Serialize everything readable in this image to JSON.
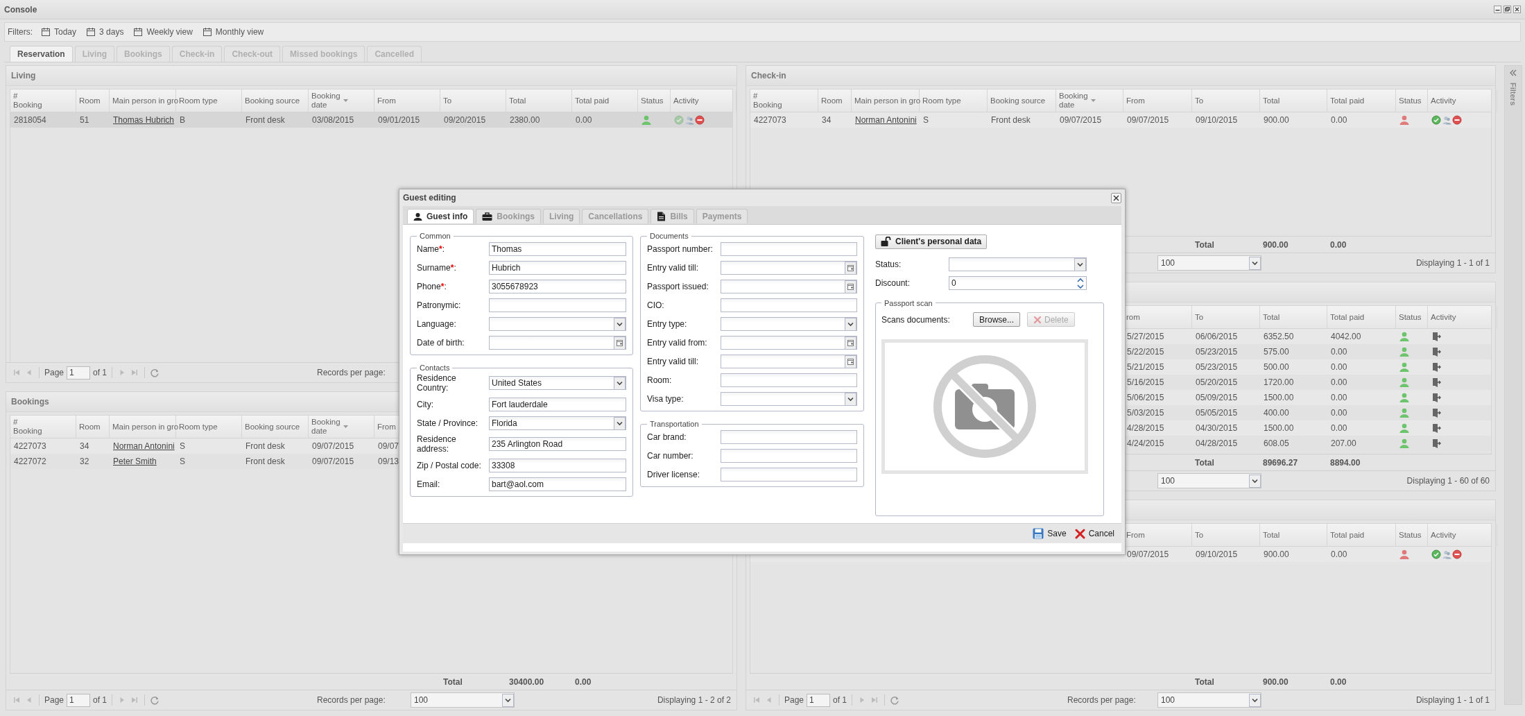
{
  "window": {
    "title": "Console"
  },
  "filters": {
    "label": "Filters:",
    "items": [
      "Today",
      "3 days",
      "Weekly view",
      "Monthly view"
    ]
  },
  "tabs": [
    {
      "label": "Reservation",
      "selected": true
    },
    {
      "label": "Living",
      "selected": false
    },
    {
      "label": "Bookings",
      "selected": false
    },
    {
      "label": "Check-in",
      "selected": false
    },
    {
      "label": "Check-out",
      "selected": false
    },
    {
      "label": "Missed bookings",
      "selected": false
    },
    {
      "label": "Cancelled",
      "selected": false
    }
  ],
  "left_panels": [
    {
      "title": "Living",
      "columns": [
        {
          "label": "#\nBooking",
          "kind": "text",
          "sorted": false
        },
        {
          "label": "Room",
          "kind": "text",
          "sorted": false
        },
        {
          "label": "Main person in gro",
          "kind": "link",
          "sorted": false
        },
        {
          "label": "Room type",
          "kind": "text",
          "sorted": false
        },
        {
          "label": "Booking source",
          "kind": "text",
          "sorted": false
        },
        {
          "label": "Booking\ndate",
          "kind": "text",
          "sorted": true
        },
        {
          "label": "From",
          "kind": "text",
          "sorted": false
        },
        {
          "label": "To",
          "kind": "text",
          "sorted": false
        },
        {
          "label": "Total",
          "kind": "text",
          "sorted": false
        },
        {
          "label": "Total paid",
          "kind": "text",
          "sorted": false
        },
        {
          "label": "Status",
          "kind": "status",
          "sorted": false
        },
        {
          "label": "Activity",
          "kind": "activity",
          "sorted": false
        }
      ],
      "rows": [
        {
          "selected": true,
          "cells": [
            "2818054",
            "51",
            "Thomas Hubrich",
            "B",
            "Front desk",
            "03/08/2015",
            "09/01/2015",
            "09/20/2015",
            "2380.00",
            "0.00",
            {
              "color": "#6cc46c"
            },
            [
              {
                "kind": "check",
                "disabled": true
              },
              {
                "kind": "guest",
                "disabled": false
              },
              {
                "kind": "cancel",
                "disabled": false
              }
            ]
          ]
        }
      ],
      "pager": {
        "page_label": "Page",
        "page": "1",
        "page_count": "of 1",
        "records_label": "Records per page:"
      }
    },
    {
      "title": "Bookings",
      "columns": [
        {
          "label": "#\nBooking",
          "kind": "text",
          "sorted": false
        },
        {
          "label": "Room",
          "kind": "text",
          "sorted": false
        },
        {
          "label": "Main person in gro",
          "kind": "link",
          "sorted": false
        },
        {
          "label": "Room type",
          "kind": "text",
          "sorted": false
        },
        {
          "label": "Booking source",
          "kind": "text",
          "sorted": false
        },
        {
          "label": "Booking\ndate",
          "kind": "text",
          "sorted": true
        },
        {
          "label": "From",
          "kind": "text",
          "sorted": false
        }
      ],
      "rows": [
        {
          "selected": false,
          "cells": [
            "4227073",
            "34",
            "Norman Antonini",
            "S",
            "Front desk",
            "09/07/2015",
            "09/07"
          ]
        },
        {
          "selected": false,
          "cells": [
            "4227072",
            "32",
            "Peter Smith",
            "S",
            "Front desk",
            "09/07/2015",
            "09/13"
          ]
        }
      ],
      "total": {
        "label": "Total",
        "total": "30400.00",
        "paid": "0.00"
      },
      "pager": {
        "page_label": "Page",
        "page": "1",
        "page_count": "of 1",
        "records_label": "Records per page:",
        "per_page": "100",
        "display": "Displaying 1 - 2 of 2"
      }
    }
  ],
  "right_panels": [
    {
      "title": "Check-in",
      "columns": [
        {
          "label": "#\nBooking",
          "kind": "text",
          "sorted": false
        },
        {
          "label": "Room",
          "kind": "text",
          "sorted": false
        },
        {
          "label": "Main person in gro",
          "kind": "link",
          "sorted": false
        },
        {
          "label": "Room type",
          "kind": "text",
          "sorted": false
        },
        {
          "label": "Booking source",
          "kind": "text",
          "sorted": false
        },
        {
          "label": "Booking\ndate",
          "kind": "text",
          "sorted": true
        },
        {
          "label": "From",
          "kind": "text",
          "sorted": false
        },
        {
          "label": "To",
          "kind": "text",
          "sorted": false
        },
        {
          "label": "Total",
          "kind": "text",
          "sorted": false
        },
        {
          "label": "Total paid",
          "kind": "text",
          "sorted": false
        },
        {
          "label": "Status",
          "kind": "status",
          "sorted": false
        },
        {
          "label": "Activity",
          "kind": "activity",
          "sorted": false
        }
      ],
      "rows": [
        {
          "selected": false,
          "cells": [
            "4227073",
            "34",
            "Norman Antonini",
            "S",
            "Front desk",
            "09/07/2015",
            "09/07/2015",
            "09/10/2015",
            "900.00",
            "0.00",
            {
              "color": "#e07a7a"
            },
            [
              {
                "kind": "check",
                "disabled": false
              },
              {
                "kind": "guest",
                "disabled": false
              },
              {
                "kind": "cancel",
                "disabled": false
              }
            ]
          ]
        }
      ],
      "total": {
        "label": "Total",
        "total": "900.00",
        "paid": "0.00"
      },
      "pager": {
        "per_page": "100",
        "display": "Displaying 1 - 1 of 1"
      }
    },
    {
      "columns": [
        {
          "label": "rom",
          "kind": "text",
          "sorted": false
        },
        {
          "label": "To",
          "kind": "text",
          "sorted": false
        },
        {
          "label": "Total",
          "kind": "text",
          "sorted": false
        },
        {
          "label": "Total paid",
          "kind": "text",
          "sorted": false
        },
        {
          "label": "Status",
          "kind": "status",
          "sorted": false
        },
        {
          "label": "Activity",
          "kind": "activity",
          "sorted": false
        }
      ],
      "rows": [
        {
          "selected": false,
          "cells": [
            "5/27/2015",
            "06/06/2015",
            "6352.50",
            "4042.00",
            {
              "color": "#6cc46c"
            },
            [
              {
                "kind": "exit",
                "disabled": false
              }
            ]
          ]
        },
        {
          "selected": false,
          "cells": [
            "5/22/2015",
            "05/23/2015",
            "575.00",
            "0.00",
            {
              "color": "#6cc46c"
            },
            [
              {
                "kind": "exit",
                "disabled": false
              }
            ]
          ]
        },
        {
          "selected": false,
          "cells": [
            "5/21/2015",
            "05/23/2015",
            "500.00",
            "0.00",
            {
              "color": "#6cc46c"
            },
            [
              {
                "kind": "exit",
                "disabled": false
              }
            ]
          ]
        },
        {
          "selected": false,
          "cells": [
            "5/16/2015",
            "05/20/2015",
            "1720.00",
            "0.00",
            {
              "color": "#6cc46c"
            },
            [
              {
                "kind": "exit",
                "disabled": false
              }
            ]
          ]
        },
        {
          "selected": false,
          "cells": [
            "5/06/2015",
            "05/09/2015",
            "1500.00",
            "0.00",
            {
              "color": "#6cc46c"
            },
            [
              {
                "kind": "exit",
                "disabled": false
              }
            ]
          ]
        },
        {
          "selected": false,
          "cells": [
            "5/03/2015",
            "05/05/2015",
            "400.00",
            "0.00",
            {
              "color": "#6cc46c"
            },
            [
              {
                "kind": "exit",
                "disabled": false
              }
            ]
          ]
        },
        {
          "selected": false,
          "cells": [
            "4/28/2015",
            "04/30/2015",
            "1500.00",
            "0.00",
            {
              "color": "#6cc46c"
            },
            [
              {
                "kind": "exit",
                "disabled": false
              }
            ]
          ]
        },
        {
          "selected": false,
          "cells": [
            "4/24/2015",
            "04/28/2015",
            "608.05",
            "207.00",
            {
              "color": "#6cc46c"
            },
            [
              {
                "kind": "exit",
                "disabled": false
              }
            ]
          ]
        }
      ],
      "total": {
        "label": "Total",
        "total": "89696.27",
        "paid": "8894.00"
      },
      "pager": {
        "per_page": "100",
        "display": "Displaying 1 - 60 of 60"
      }
    },
    {
      "columns": [
        {
          "label": "From",
          "kind": "text",
          "sorted": false
        },
        {
          "label": "To",
          "kind": "text",
          "sorted": false
        },
        {
          "label": "Total",
          "kind": "text",
          "sorted": false
        },
        {
          "label": "Total paid",
          "kind": "text",
          "sorted": false
        },
        {
          "label": "Status",
          "kind": "status",
          "sorted": false
        },
        {
          "label": "Activity",
          "kind": "activity",
          "sorted": false
        }
      ],
      "rows": [
        {
          "selected": false,
          "cells": [
            "09/07/2015",
            "09/10/2015",
            "900.00",
            "0.00",
            {
              "color": "#e07a7a"
            },
            [
              {
                "kind": "check",
                "disabled": false
              },
              {
                "kind": "guest",
                "disabled": false
              },
              {
                "kind": "cancel",
                "disabled": false
              }
            ]
          ]
        }
      ],
      "total": {
        "label": "Total",
        "total": "900.00",
        "paid": "0.00"
      },
      "pager": {
        "page_label": "Page",
        "page": "1",
        "page_count": "of 1",
        "records_label": "Records per page:",
        "per_page": "100",
        "display": "Displaying 1 - 1 of 1"
      }
    }
  ],
  "filters_sidebar": {
    "label": "Filters"
  },
  "dialog": {
    "title": "Guest editing",
    "tabs": [
      {
        "label": "Guest info",
        "kind": "person",
        "selected": true
      },
      {
        "label": "Bookings",
        "kind": "briefcase",
        "selected": false
      },
      {
        "label": "Living",
        "kind": "plain",
        "selected": false
      },
      {
        "label": "Cancellations",
        "kind": "plain",
        "selected": false
      },
      {
        "label": "Bills",
        "kind": "document",
        "selected": false
      },
      {
        "label": "Payments",
        "kind": "plain",
        "selected": false
      }
    ],
    "columns": [
      [
        {
          "legend": "Common",
          "fields": [
            {
              "label": "Name",
              "mark": "*",
              "suffix": ":",
              "kind": "text",
              "value": "Thomas"
            },
            {
              "label": "Surname",
              "mark": "*",
              "suffix": ":",
              "kind": "text",
              "value": "Hubrich"
            },
            {
              "label": "Phone",
              "mark": "*",
              "suffix": ":",
              "kind": "text",
              "value": "3055678923"
            },
            {
              "label": "Patronymic:",
              "kind": "text"
            },
            {
              "label": "Language:",
              "kind": "combo"
            },
            {
              "label": "Date of birth:",
              "kind": "date"
            }
          ]
        },
        {
          "legend": "Contacts",
          "fields": [
            {
              "label": "Residence\nCountry:",
              "kind": "combo",
              "value": "United States"
            },
            {
              "label": "City:",
              "kind": "text",
              "value": "Fort lauderdale"
            },
            {
              "label": "State / Province:",
              "kind": "combo",
              "value": "Florida"
            },
            {
              "label": "Residence\naddress:",
              "kind": "text",
              "value": "235 Arlington Road"
            },
            {
              "label": "Zip / Postal code:",
              "kind": "text",
              "value": "33308"
            },
            {
              "label": "Email:",
              "kind": "text",
              "value": "bart@aol.com"
            }
          ]
        }
      ],
      [
        {
          "legend": "Documents",
          "fields": [
            {
              "label": "Passport number:",
              "kind": "text"
            },
            {
              "label": "Entry valid till:",
              "kind": "date"
            },
            {
              "label": "Passport issued:",
              "kind": "date"
            },
            {
              "label": "CIO:",
              "kind": "text"
            },
            {
              "label": "Entry type:",
              "kind": "combo"
            },
            {
              "label": "Entry valid from:",
              "kind": "date"
            },
            {
              "label": "Entry valid till:",
              "kind": "date"
            },
            {
              "label": "Room:",
              "kind": "text"
            },
            {
              "label": "Visa type:",
              "kind": "combo"
            }
          ]
        },
        {
          "legend": "Transportation",
          "fields": [
            {
              "label": "Car brand:",
              "kind": "text"
            },
            {
              "label": "Car number:",
              "kind": "text"
            },
            {
              "label": "Driver license:",
              "kind": "text"
            }
          ]
        }
      ]
    ],
    "side": {
      "button": "Client's personal data",
      "fields": [
        {
          "label": "Status:",
          "kind": "combo"
        },
        {
          "label": "Discount:",
          "kind": "spin",
          "value": "0"
        }
      ],
      "scan": {
        "legend": "Passport scan",
        "label": "Scans documents:",
        "browse": "Browse...",
        "delete": {
          "label": "Delete",
          "disabled": true
        }
      }
    },
    "buttons": [
      {
        "label": "Save",
        "kind": "save"
      },
      {
        "label": "Cancel",
        "kind": "cancel"
      }
    ]
  }
}
